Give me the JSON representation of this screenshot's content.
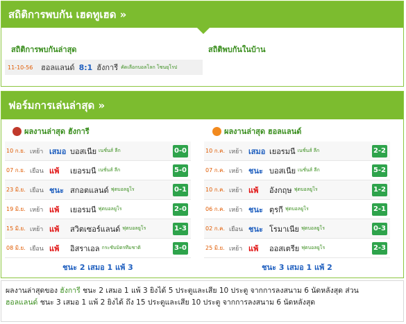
{
  "h2h": {
    "title": "สถิติการพบกัน เฮดทูเฮด »",
    "latest_label": "สถิติการพบกันล่าสุด",
    "home_label": "สถิติพบกันในบ้าน",
    "match": {
      "date": "11-10-56",
      "home": "ฮอลแลนด์",
      "score": "8:1",
      "away": "ฮังการี",
      "league": "คัดเลือกบอลโลก โซนยุโรป"
    }
  },
  "form": {
    "title": "ฟอร์มการเล่นล่าสุด »",
    "left": {
      "heading": "ผลงานล่าสุด ฮังการี",
      "badge_color": "#c0392b",
      "rows": [
        {
          "date": "10 ก.ย.",
          "venue": "เหย้า",
          "result": "เสมอ",
          "rclass": "draw",
          "opp": "บอสเนีย",
          "league": "เนชั่นส์ ลีก",
          "score": "0-0"
        },
        {
          "date": "07 ก.ย.",
          "venue": "เยือน",
          "result": "แพ้",
          "rclass": "loss",
          "opp": "เยอรมนี",
          "league": "เนชั่นส์ ลีก",
          "score": "5-0"
        },
        {
          "date": "23 มิ.ย.",
          "venue": "เยือน",
          "result": "ชนะ",
          "rclass": "win",
          "opp": "สกอตแลนด์",
          "league": "ฟุตบอลยูโร",
          "score": "0-1"
        },
        {
          "date": "19 มิ.ย.",
          "venue": "เหย้า",
          "result": "แพ้",
          "rclass": "loss",
          "opp": "เยอรมนี",
          "league": "ฟุตบอลยูโร",
          "score": "2-0"
        },
        {
          "date": "15 มิ.ย.",
          "venue": "เหย้า",
          "result": "แพ้",
          "rclass": "loss",
          "opp": "สวิตเซอร์แลนด์",
          "league": "ฟุตบอลยูโร",
          "score": "1-3"
        },
        {
          "date": "08 มิ.ย.",
          "venue": "เยือน",
          "result": "แพ้",
          "rclass": "loss",
          "opp": "อิสราเอล",
          "league": "กระชับมิตรทีมชาติ",
          "score": "3-0"
        }
      ],
      "summary": "ชนะ 2 เสมอ 1 แพ้ 3"
    },
    "right": {
      "heading": "ผลงานล่าสุด ฮอลแลนด์",
      "badge_color": "#f28a1e",
      "rows": [
        {
          "date": "10 ก.ค.",
          "venue": "เหย้า",
          "result": "เสมอ",
          "rclass": "draw",
          "opp": "เยอรมนี",
          "league": "เนชั่นส์ ลีก",
          "score": "2-2"
        },
        {
          "date": "07 ก.ค.",
          "venue": "เหย้า",
          "result": "ชนะ",
          "rclass": "win",
          "opp": "บอสเนีย",
          "league": "เนชั่นส์ ลีก",
          "score": "5-2"
        },
        {
          "date": "10 ก.ค.",
          "venue": "เหย้า",
          "result": "แพ้",
          "rclass": "loss",
          "opp": "อังกฤษ",
          "league": "ฟุตบอลยูโร",
          "score": "1-2"
        },
        {
          "date": "06 ก.ค.",
          "venue": "เหย้า",
          "result": "ชนะ",
          "rclass": "win",
          "opp": "ตุรกี",
          "league": "ฟุตบอลยูโร",
          "score": "2-1"
        },
        {
          "date": "02 ก.ค.",
          "venue": "เยือน",
          "result": "ชนะ",
          "rclass": "win",
          "opp": "โรมาเนีย",
          "league": "ฟุตบอลยูโร",
          "score": "0-3"
        },
        {
          "date": "25 มิ.ย.",
          "venue": "เหย้า",
          "result": "แพ้",
          "rclass": "loss",
          "opp": "ออสเตรีย",
          "league": "ฟุตบอลยูโร",
          "score": "2-3"
        }
      ],
      "summary": "ชนะ 3 เสมอ 1 แพ้ 2"
    }
  },
  "note": {
    "line1_prefix": "ผลงานล่าสุดของ ",
    "team1": "ฮังการี",
    "line1_rest": " ชนะ 2 เสมอ 1 แพ้ 3 ยิงได้ 5 ประตูและเสีย 10 ประตู จากการลงสนาม 6 นัดหลังสุด ส่วน",
    "team2": "ฮอลแลนด์",
    "line2_rest": " ชนะ 3 เสมอ 1 แพ้ 2 ยิงได้ ถึง 15 ประตูและเสีย 10 ประตู จากการลงสนาม 6 นัดหลังสุด"
  }
}
